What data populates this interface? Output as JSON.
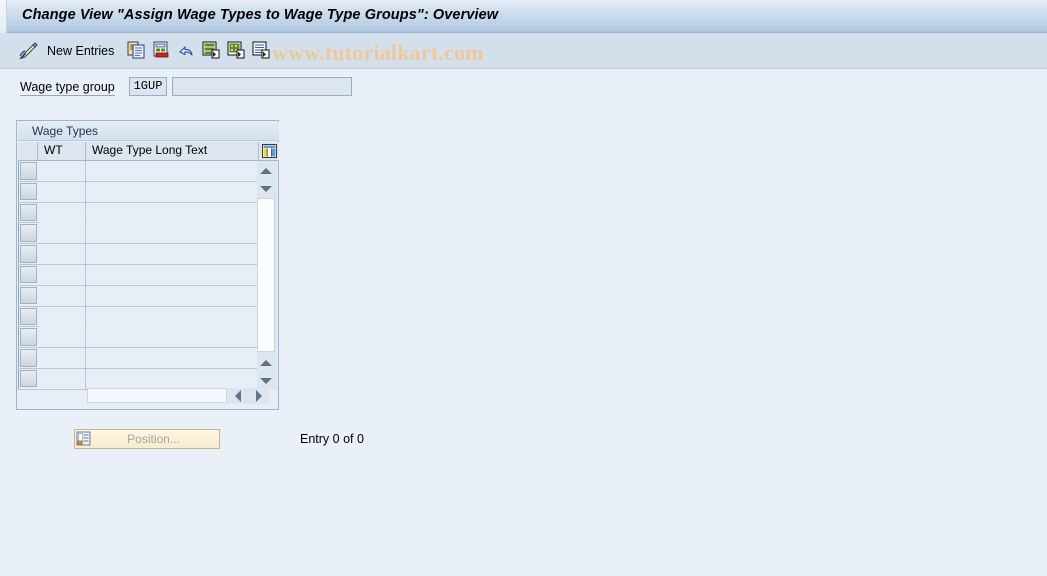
{
  "window": {
    "title": "Change View \"Assign Wage Types to Wage Type Groups\": Overview"
  },
  "toolbar": {
    "display_change_icon": "pencil-icon",
    "new_entries_label": "New Entries",
    "icons": [
      {
        "name": "copy-icon",
        "title": "Copy As..."
      },
      {
        "name": "delete-icon",
        "title": "Delete"
      },
      {
        "name": "undo-icon",
        "title": "Undo Change"
      },
      {
        "name": "select-all-icon",
        "title": "Select All"
      },
      {
        "name": "select-block-icon",
        "title": "Select Block"
      },
      {
        "name": "deselect-all-icon",
        "title": "Deselect All"
      }
    ],
    "watermark": "www.tutorialkart.com"
  },
  "form": {
    "wage_type_group_label": "Wage type group",
    "wage_type_group_key": "1GUP",
    "wage_type_group_text": "",
    "wage_type_group_text_placeholder": ""
  },
  "table": {
    "title": "Wage Types",
    "columns": [
      "WT",
      "Wage Type Long Text"
    ],
    "config_icon": "column-settings-icon",
    "rows": [
      {
        "wt": "",
        "long_text": ""
      },
      {
        "wt": "",
        "long_text": ""
      },
      {
        "wt": "",
        "long_text": ""
      },
      {
        "wt": "",
        "long_text": ""
      },
      {
        "wt": "",
        "long_text": ""
      },
      {
        "wt": "",
        "long_text": ""
      },
      {
        "wt": "",
        "long_text": ""
      },
      {
        "wt": "",
        "long_text": ""
      },
      {
        "wt": "",
        "long_text": ""
      },
      {
        "wt": "",
        "long_text": ""
      },
      {
        "wt": "",
        "long_text": ""
      }
    ]
  },
  "footer": {
    "position_button_label": "Position...",
    "position_button_icon": "position-icon",
    "entry_count": "Entry 0 of 0"
  },
  "colors": {
    "title_bar": "#b5cbe3",
    "toolbar": "#d3dfeb",
    "page_background": "#eaf0f7",
    "watermark": "#efc79b",
    "field_background": "#dde6f0",
    "button_background": "#f7ecd0"
  }
}
